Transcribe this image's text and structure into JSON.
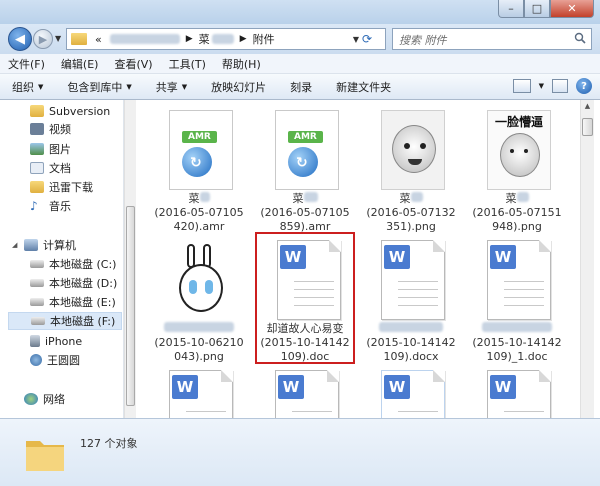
{
  "titlebar": {
    "min": "–",
    "max": "□",
    "close": "✕"
  },
  "nav": {
    "back": "◀",
    "forward": "▶"
  },
  "address": {
    "prefix": "«",
    "segment_folder": "菜",
    "segment_current": "附件"
  },
  "search": {
    "placeholder": "搜索 附件"
  },
  "menu": {
    "items": [
      "文件(F)",
      "编辑(E)",
      "查看(V)",
      "工具(T)",
      "帮助(H)"
    ]
  },
  "toolbar": {
    "organize": "组织",
    "include": "包含到库中",
    "share": "共享",
    "slideshow": "放映幻灯片",
    "burn": "刻录",
    "new_folder": "新建文件夹",
    "help": "?"
  },
  "sidebar": {
    "favorites": [
      "Subversion",
      "视频",
      "图片",
      "文档",
      "迅雷下载",
      "音乐"
    ],
    "computer": "计算机",
    "drives": [
      "本地磁盘 (C:)",
      "本地磁盘 (D:)",
      "本地磁盘 (E:)",
      "本地磁盘 (F:)"
    ],
    "devices": [
      "iPhone",
      "王圆圆"
    ],
    "network": "网络"
  },
  "files": [
    {
      "type": "amr",
      "line1": "菜",
      "line2": "(2016-05-07105",
      "line3": "420).amr"
    },
    {
      "type": "amr",
      "line1": "菜",
      "line2": "(2016-05-07105",
      "line3": "859).amr"
    },
    {
      "type": "meme-cat",
      "line1": "菜",
      "line2": "(2016-05-07132",
      "line3": "351).png"
    },
    {
      "type": "meme-face",
      "title": "一脸懵逼",
      "line1": "菜",
      "line2": "(2016-05-07151",
      "line3": "948).png"
    },
    {
      "type": "meme-rabbit",
      "line1": "",
      "line2": "(2015-10-06210",
      "line3": "043).png"
    },
    {
      "type": "doc",
      "badge": "W",
      "line1": "却道故人心易变",
      "line2": "(2015-10-14142",
      "line3": "109).doc"
    },
    {
      "type": "doc",
      "badge": "W",
      "line1": "",
      "line2": "(2015-10-14142",
      "line3": "109).docx"
    },
    {
      "type": "doc",
      "badge": "W",
      "line1": "",
      "line2": "(2015-10-14142",
      "line3": "109)_1.doc"
    },
    {
      "type": "doc",
      "badge": "W"
    },
    {
      "type": "doc",
      "badge": "W"
    },
    {
      "type": "doc",
      "badge": "W"
    },
    {
      "type": "doc",
      "badge": "W"
    }
  ],
  "status": {
    "count_text": "127 个对象"
  },
  "colors": {
    "selection_border": "#cc1f1f",
    "wps_badge": "#4a7bd0",
    "amr_tag": "#5ab44a"
  }
}
